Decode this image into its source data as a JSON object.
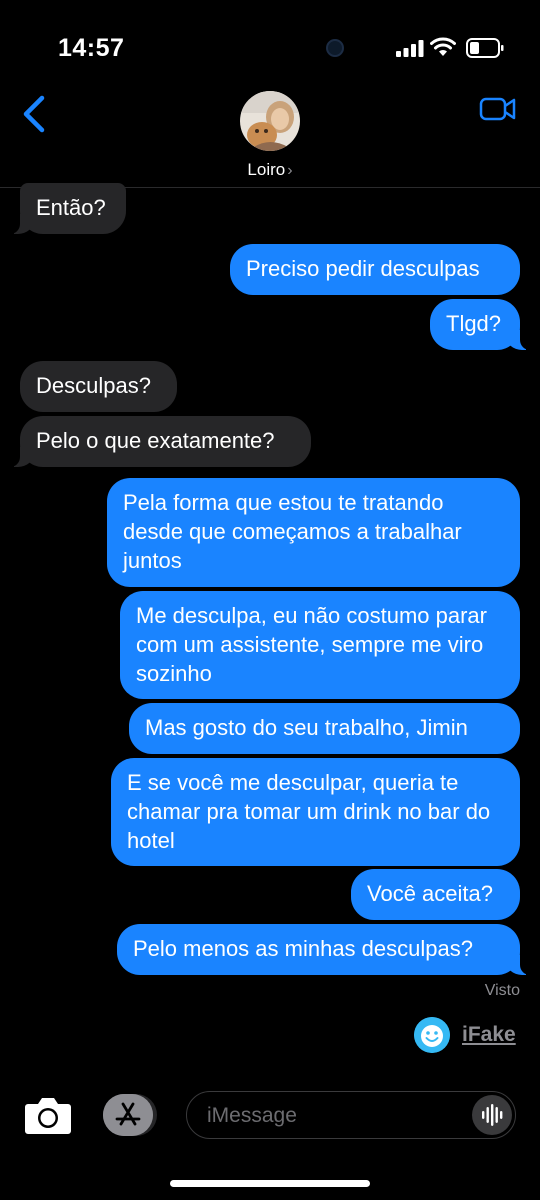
{
  "status_bar": {
    "time": "14:57",
    "icons": [
      "signal-icon",
      "wifi-icon",
      "battery-icon"
    ]
  },
  "header": {
    "back_icon": "chevron-left-icon",
    "contact_name": "Loiro",
    "contact_chevron": "›",
    "video_icon": "video-camera-icon",
    "accent_color": "#1a84ff"
  },
  "messages": [
    {
      "direction": "incoming",
      "text": "Então?"
    },
    {
      "direction": "outgoing",
      "text": "Preciso pedir desculpas"
    },
    {
      "direction": "outgoing",
      "text": "Tlgd?"
    },
    {
      "direction": "incoming",
      "text": "Desculpas?"
    },
    {
      "direction": "incoming",
      "text": "Pelo o que exatamente?"
    },
    {
      "direction": "outgoing",
      "text": "Pela forma que estou te tratando desde que começamos a trabalhar juntos"
    },
    {
      "direction": "outgoing",
      "text": "Me desculpa, eu não costumo parar com um assistente, sempre me viro sozinho"
    },
    {
      "direction": "outgoing",
      "text": "Mas gosto do seu trabalho, Jimin"
    },
    {
      "direction": "outgoing",
      "text": "E se você me desculpar, queria te chamar pra tomar um drink no bar do hotel"
    },
    {
      "direction": "outgoing",
      "text": "Você aceita?"
    },
    {
      "direction": "outgoing",
      "text": "Pelo menos as minhas desculpas?"
    }
  ],
  "read_receipt": "Visto",
  "watermark": {
    "label": "iFake",
    "icon": "smiley-face-icon"
  },
  "composer": {
    "placeholder": "iMessage",
    "camera_icon": "camera-icon",
    "apps_icon": "app-store-icon",
    "audio_icon": "audio-waveform-icon"
  },
  "colors": {
    "outgoing_bubble": "#1a84ff",
    "incoming_bubble": "#262628",
    "background": "#000000"
  }
}
